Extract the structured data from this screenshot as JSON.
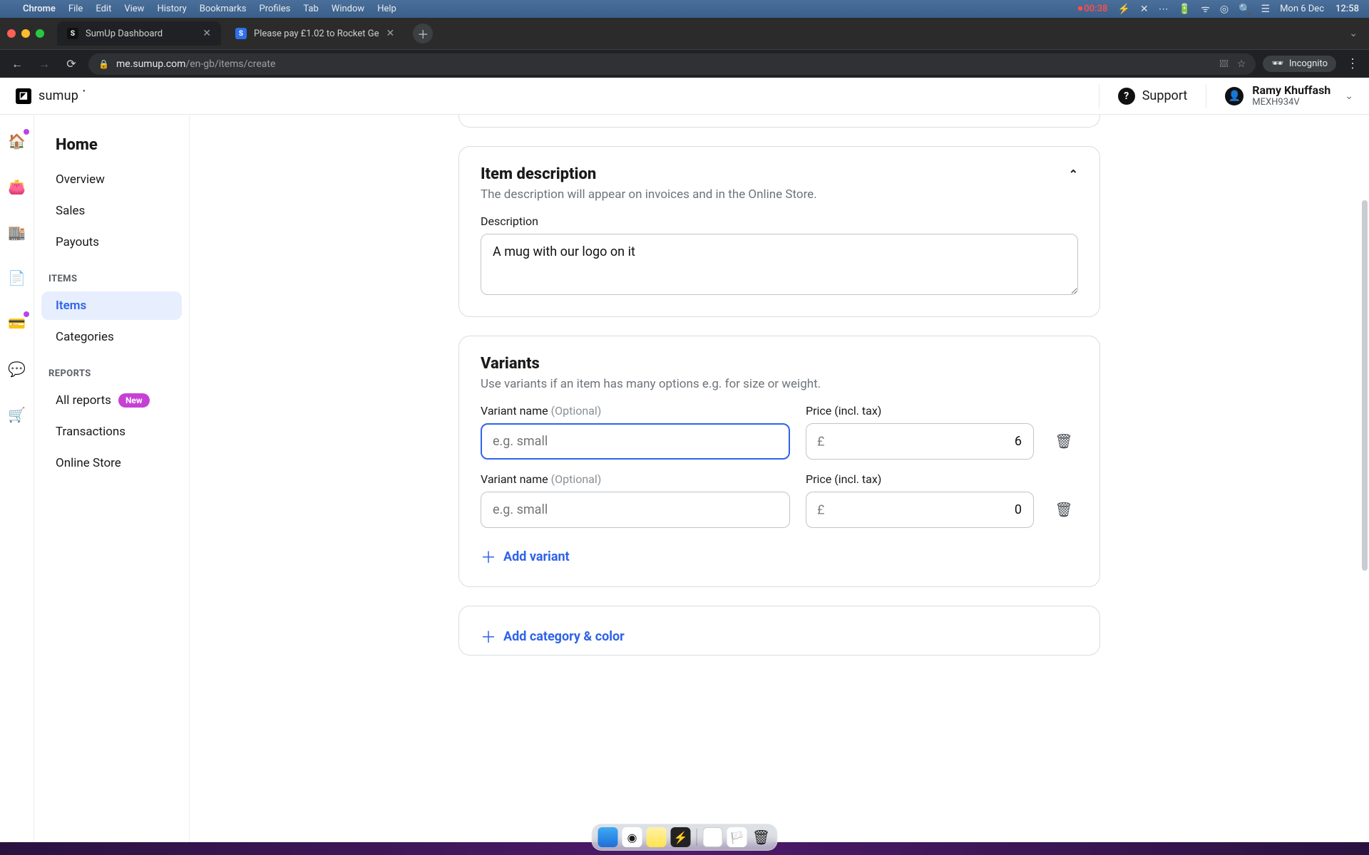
{
  "mac": {
    "app": "Chrome",
    "menus": [
      "File",
      "Edit",
      "View",
      "History",
      "Bookmarks",
      "Profiles",
      "Tab",
      "Window",
      "Help"
    ],
    "rec_time": "00:38",
    "date": "Mon 6 Dec",
    "clock": "12:58"
  },
  "chrome": {
    "tabs": [
      {
        "title": "SumUp Dashboard",
        "active": true
      },
      {
        "title": "Please pay £1.02 to Rocket Ge",
        "active": false
      }
    ],
    "url_host": "me.sumup.com",
    "url_path": "/en-gb/items/create",
    "incognito": "Incognito"
  },
  "app": {
    "brand": "sumup",
    "support": "Support",
    "user_name": "Ramy Khuffash",
    "user_code": "MEXH934V"
  },
  "sidebar": {
    "home": "Home",
    "items_primary": [
      "Overview",
      "Sales",
      "Payouts"
    ],
    "section_items": "ITEMS",
    "items_secondary": [
      "Items",
      "Categories"
    ],
    "section_reports": "REPORTS",
    "reports": [
      {
        "label": "All reports",
        "badge": "New"
      },
      {
        "label": "Transactions"
      },
      {
        "label": "Online Store"
      }
    ]
  },
  "desc_card": {
    "title": "Item description",
    "sub": "The description will appear on invoices and in the Online Store.",
    "label": "Description",
    "value": "A mug with our logo on it"
  },
  "variants": {
    "title": "Variants",
    "sub": "Use variants if an item has many options e.g. for size or weight.",
    "name_label": "Variant name ",
    "name_optional": "(Optional)",
    "price_label": "Price (incl. tax)",
    "placeholder": "e.g. small",
    "currency": "£",
    "rows": [
      {
        "name": "",
        "price": "6"
      },
      {
        "name": "",
        "price": "0"
      }
    ],
    "add": "Add variant"
  },
  "catcolor": {
    "add": "Add category & color"
  }
}
